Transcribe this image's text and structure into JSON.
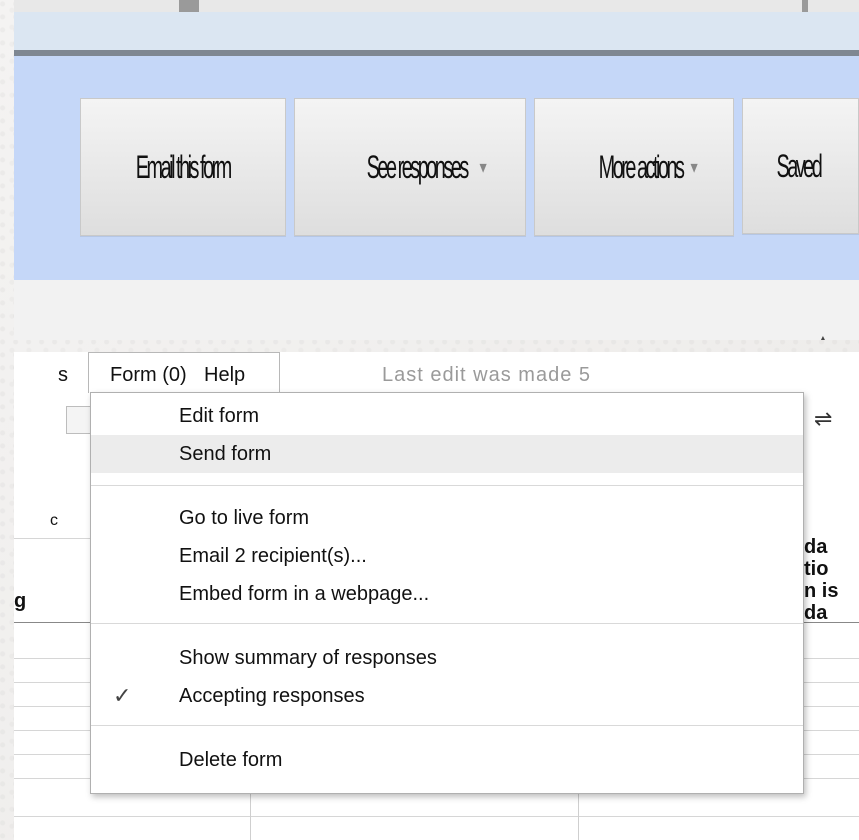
{
  "toolbar": {
    "email_form": "Email this form",
    "see_responses": "See responses",
    "more_actions": "More actions",
    "saved": "Saved",
    "dropdown_glyph": "▾",
    "collapse_glyph": "▲"
  },
  "menubar": {
    "left_partial": "s",
    "form": "Form (0)",
    "help": "Help",
    "status": "Last edit was made 5"
  },
  "sheet_peek": {
    "col_c": "c",
    "g_label": "g",
    "right_1": "da",
    "right_2": "tio",
    "right_3": "n is",
    "right_4": "da"
  },
  "form_menu": {
    "items": [
      {
        "label": "Edit form"
      },
      {
        "label": "Send form"
      },
      {
        "label": "Go to live form"
      },
      {
        "label": "Email 2 recipient(s)..."
      },
      {
        "label": "Embed form in a webpage..."
      },
      {
        "label": "Show summary of responses"
      },
      {
        "label": "Accepting responses",
        "checked": true
      },
      {
        "label": "Delete form"
      }
    ],
    "check_glyph": "✓"
  },
  "colors": {
    "toolbar_band": "#c5d7f8",
    "menu_highlight": "#ececec"
  }
}
